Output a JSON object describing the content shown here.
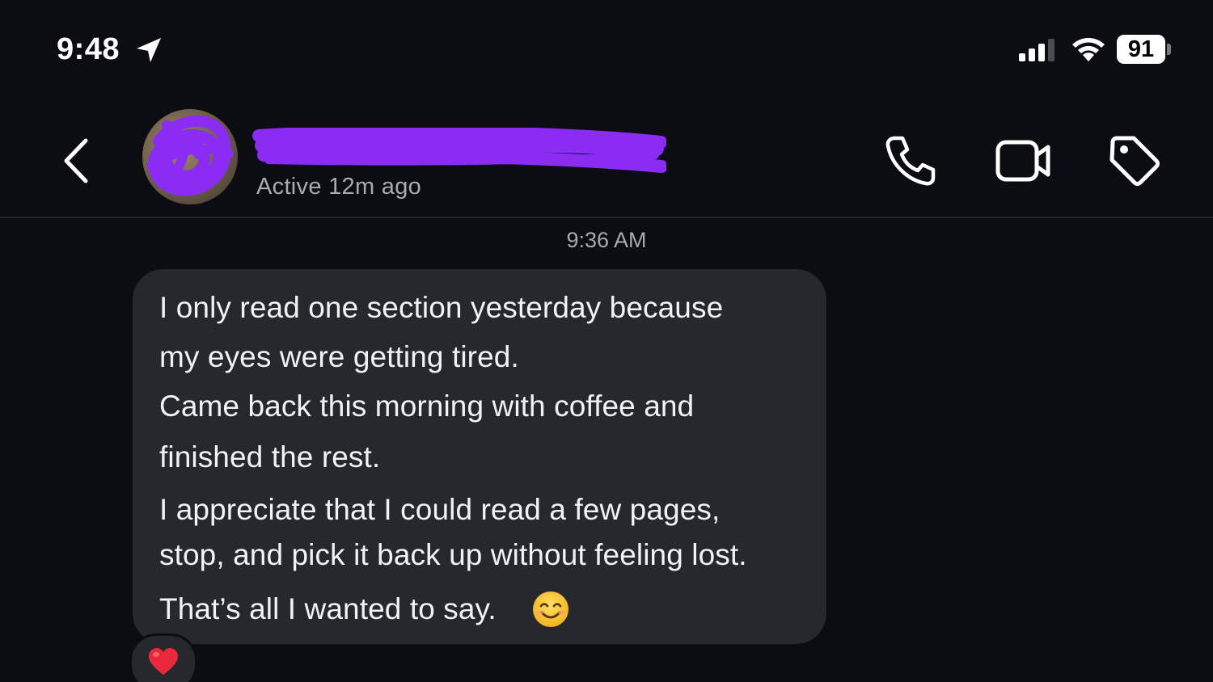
{
  "status_bar": {
    "time": "9:48",
    "battery": "91",
    "icons": [
      "location-arrow-icon",
      "cellular-signal-icon",
      "wifi-icon",
      "battery-icon"
    ]
  },
  "header": {
    "back_icon": "chevron-left-icon",
    "contact_name": "[redacted]",
    "active_status": "Active 12m ago",
    "actions": [
      "phone-icon",
      "video-camera-icon",
      "tag-icon"
    ],
    "redaction_color": "#8b2cf5"
  },
  "conversation": {
    "timestamp": "9:36 AM",
    "message": {
      "lines": [
        "I only read one section yesterday because",
        "my eyes were getting tired.",
        "Came back this morning with coffee and",
        "finished the rest.",
        "I appreciate that I could read a few pages,",
        "stop, and pick it back up without feeling lost.",
        "That’s all I wanted to say."
      ],
      "trailing_emoji": "smiling-face-icon",
      "reaction": "heart-icon"
    }
  },
  "colors": {
    "background": "#0b0d12",
    "bubble": "#25282d",
    "secondary_text": "#a7aab2",
    "heart": "#e8293b"
  }
}
